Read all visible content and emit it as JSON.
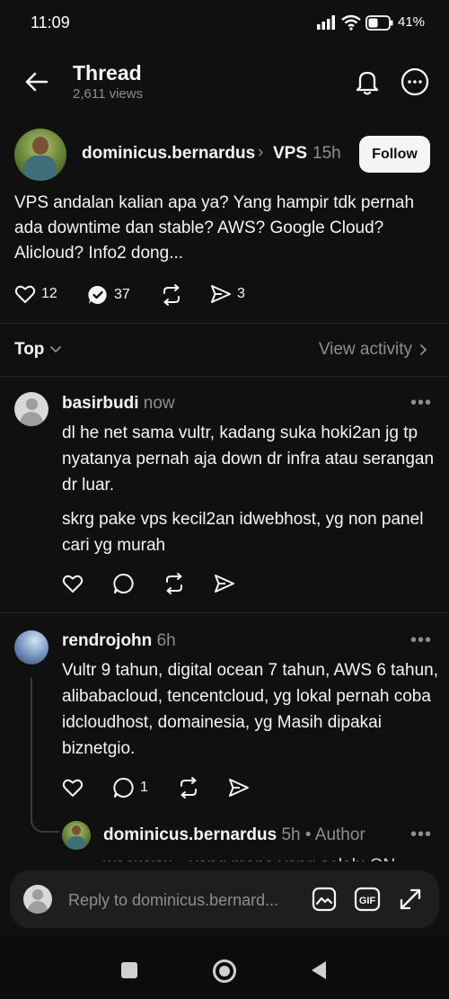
{
  "status_bar": {
    "time": "11:09",
    "battery": "41%"
  },
  "header": {
    "title": "Thread",
    "views": "2,611 views"
  },
  "post": {
    "username": "dominicus.bernardus",
    "separator": "›",
    "tag": "VPS",
    "time": "15h",
    "follow_label": "Follow",
    "text": "VPS andalan kalian apa ya? Yang hampir tdk pernah ada downtime dan stable? AWS? Google Cloud? Alicloud? Info2 dong...",
    "likes": "12",
    "replies": "37",
    "shares": "3"
  },
  "sort": {
    "label": "Top",
    "view_activity": "View activity"
  },
  "replies": [
    {
      "username": "basirbudi",
      "time": "now",
      "paragraph1": "dl he net sama vultr, kadang suka hoki2an jg tp nyatanya pernah aja down dr infra atau serangan dr luar.",
      "paragraph2": "skrg pake vps kecil2an idwebhost, yg non panel cari yg murah"
    },
    {
      "username": "rendrojohn",
      "time": "6h",
      "text": "Vultr 9 tahun, digital ocean 7 tahun, AWS 6 tahun, alibabacloud, tencentcloud, yg lokal pernah coba idcloudhost, domainesia, yg Masih dipakai biznetgio.",
      "reply_count": "1"
    },
    {
      "username": "dominicus.bernardus",
      "time": "5h",
      "badge": "• Author",
      "text": "waowww... yang mana yang selalu ON"
    }
  ],
  "reply_bar": {
    "placeholder": "Reply to dominicus.bernard..."
  },
  "colors": {
    "background": "#101010",
    "text": "#f3f5f7",
    "muted": "#8e8e8e",
    "accent_check": "#f3f5f7"
  }
}
